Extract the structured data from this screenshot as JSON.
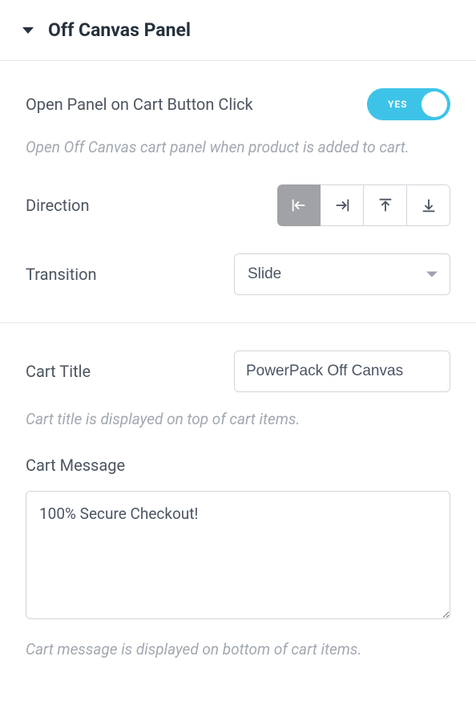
{
  "section": {
    "title": "Off Canvas Panel"
  },
  "open_on_click": {
    "label": "Open Panel on Cart Button Click",
    "state_label": "YES",
    "desc": "Open Off Canvas cart panel when product is added to cart."
  },
  "direction": {
    "label": "Direction",
    "options": [
      "left",
      "right",
      "top",
      "bottom"
    ],
    "selected": "left"
  },
  "transition": {
    "label": "Transition",
    "value": "Slide"
  },
  "cart_title": {
    "label": "Cart Title",
    "value": "PowerPack Off Canvas",
    "desc": "Cart title is displayed on top of cart items."
  },
  "cart_message": {
    "label": "Cart Message",
    "value": "100% Secure Checkout!",
    "desc": "Cart message is displayed on bottom of cart items."
  }
}
